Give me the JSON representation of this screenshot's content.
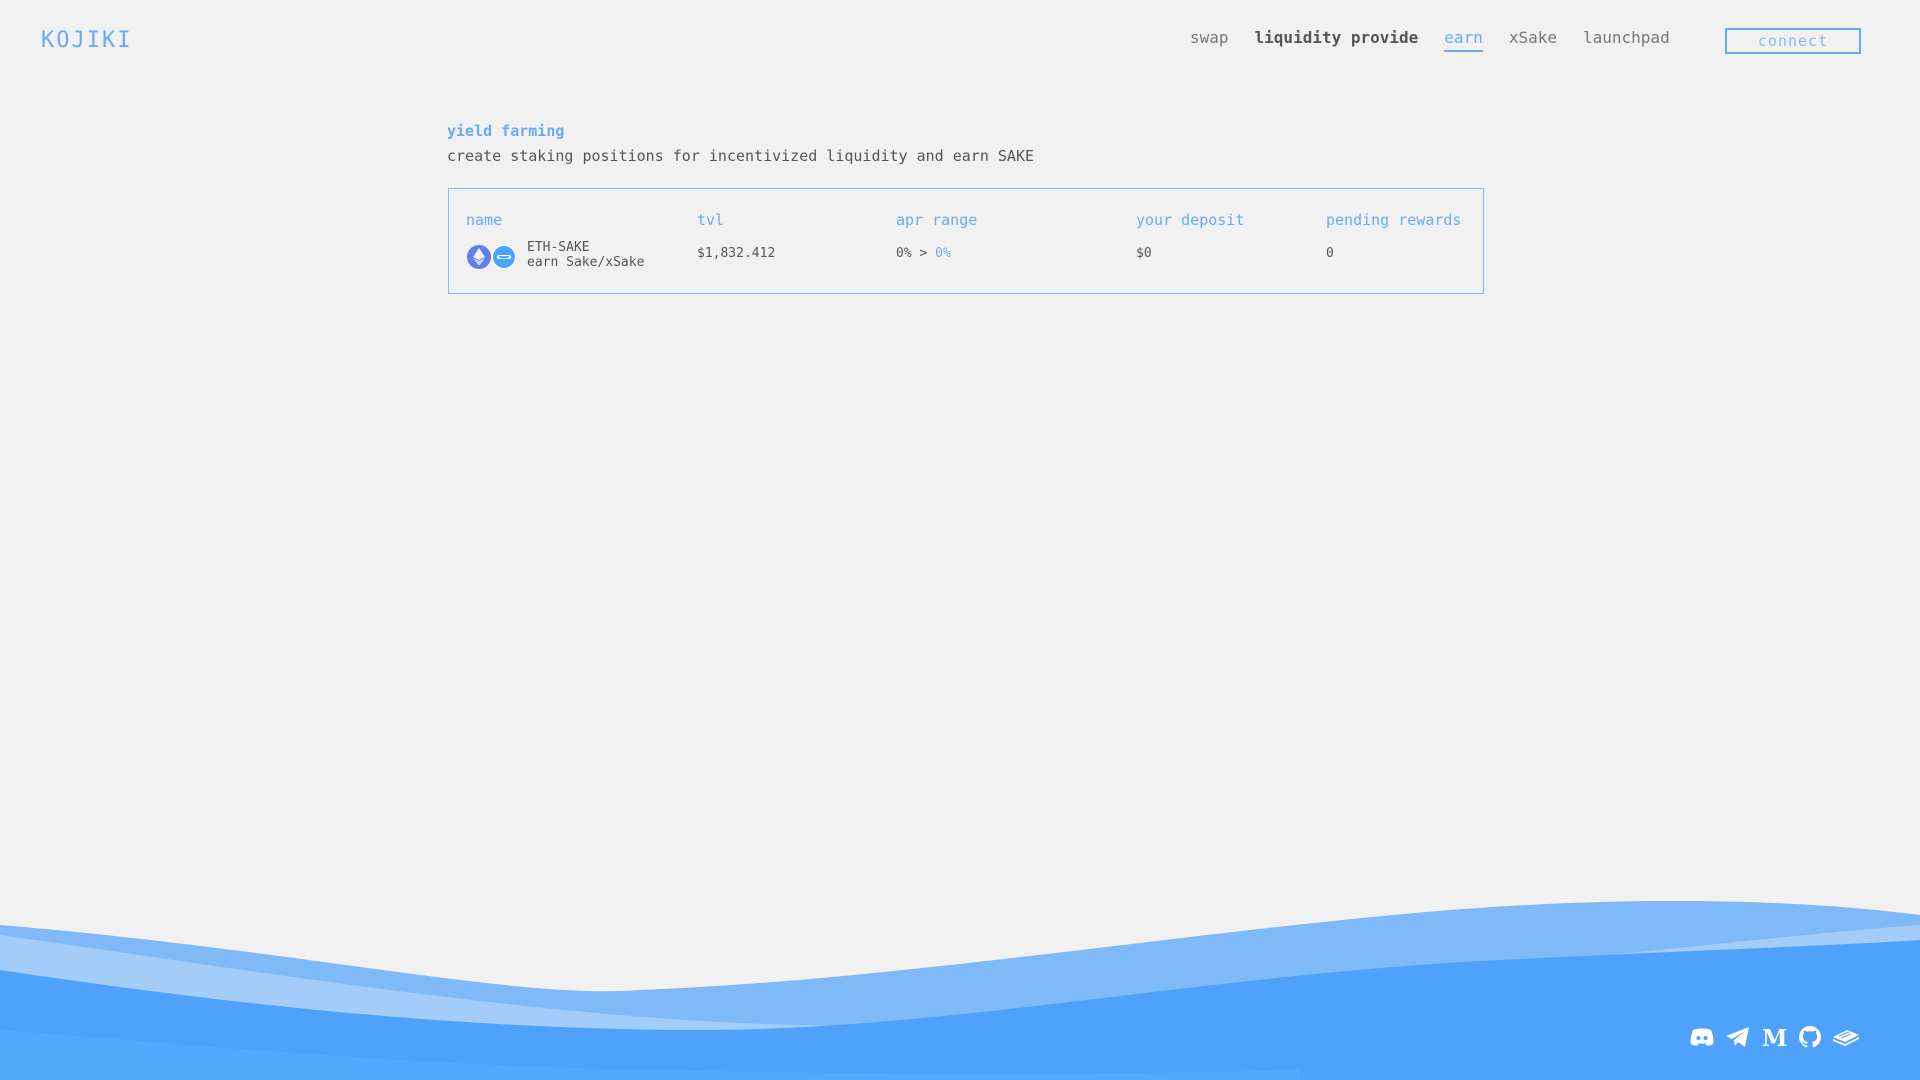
{
  "header": {
    "logo_text": "KOJIKI",
    "nav": [
      {
        "label": "swap"
      },
      {
        "label": "liquidity provide"
      },
      {
        "label": "earn"
      },
      {
        "label": "xSake"
      },
      {
        "label": "launchpad"
      }
    ],
    "connect_label": "connect"
  },
  "page": {
    "title": "yield farming",
    "subtitle": "create staking positions for incentivized liquidity and earn SAKE"
  },
  "table": {
    "columns": [
      "name",
      "tvl",
      "apr range",
      "your deposit",
      "pending rewards"
    ],
    "rows": [
      {
        "pair": "ETH-SAKE",
        "earn": "earn Sake/xSake",
        "tvl": "$1,832.412",
        "apr_min": "0% >",
        "apr_max": "0%",
        "deposit": "$0",
        "pending": "0",
        "icons": [
          "eth-icon",
          "sake-icon"
        ]
      }
    ]
  },
  "footer": {
    "socials": [
      "discord-icon",
      "telegram-icon",
      "medium-icon",
      "github-icon",
      "docs-icon"
    ]
  },
  "colors": {
    "accent": "#6aaaf5",
    "wave_dark": "#4a9ffc",
    "wave_light": "#80bbf8",
    "background": "#f1f1f1"
  }
}
